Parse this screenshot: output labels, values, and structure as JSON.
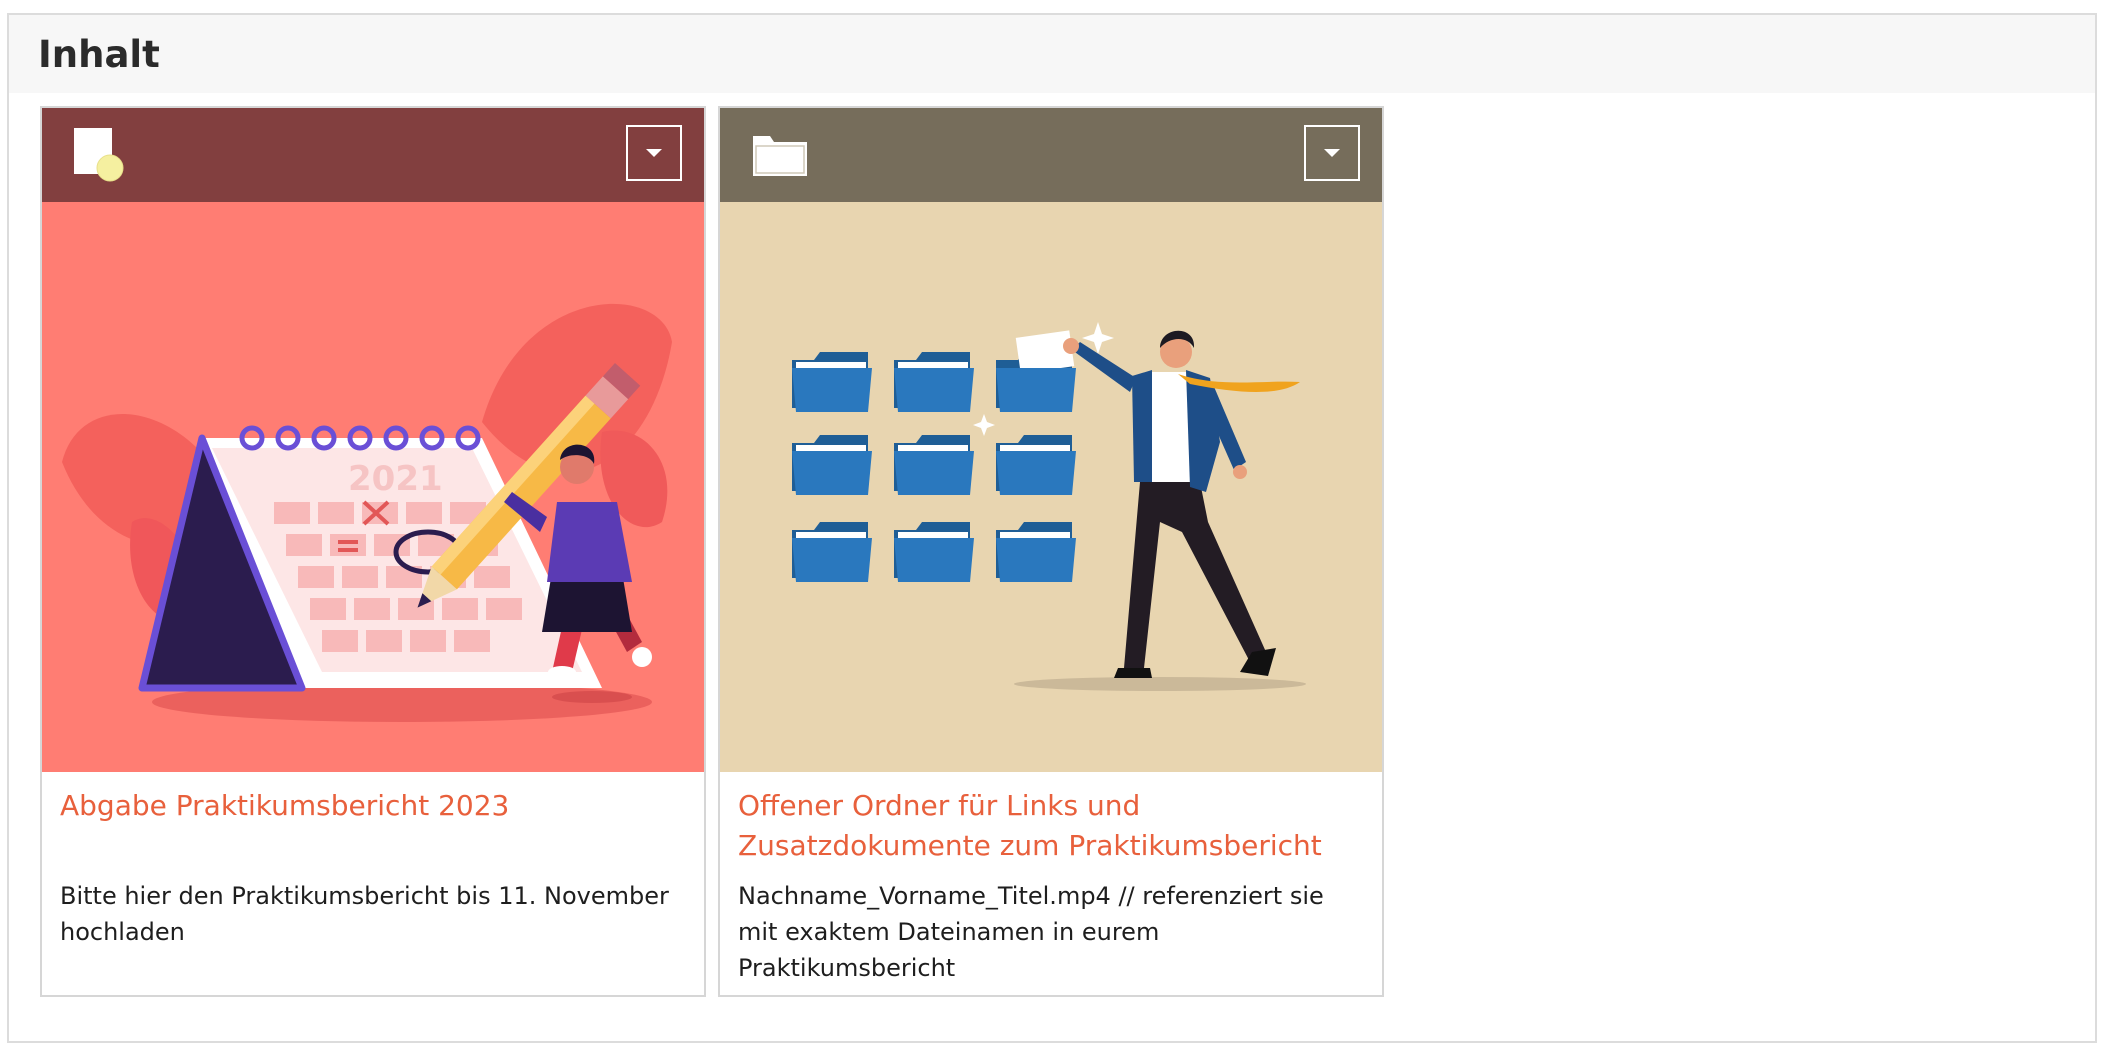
{
  "section": {
    "title": "Inhalt"
  },
  "cards": [
    {
      "type_icon": "assignment-icon",
      "menu_icon": "caret-down-icon",
      "header_color": "#823f3f",
      "image_bg": "#ff7d73",
      "image_year": "2021",
      "title": "Abgabe Praktikumsbericht 2023",
      "description": "Bitte hier den Praktikumsbericht bis 11. November hochladen"
    },
    {
      "type_icon": "folder-icon",
      "menu_icon": "caret-down-icon",
      "header_color": "#766d5b",
      "image_bg": "#e8d5b0",
      "title": "Offener Ordner für Links und Zusatzdokumente zum Praktikumsbericht",
      "description": "Nachname_Vorname_Titel.mp4 // referenziert sie mit exaktem Dateinamen in eurem Praktikumsbericht"
    }
  ],
  "colors": {
    "link": "#e8603c"
  }
}
